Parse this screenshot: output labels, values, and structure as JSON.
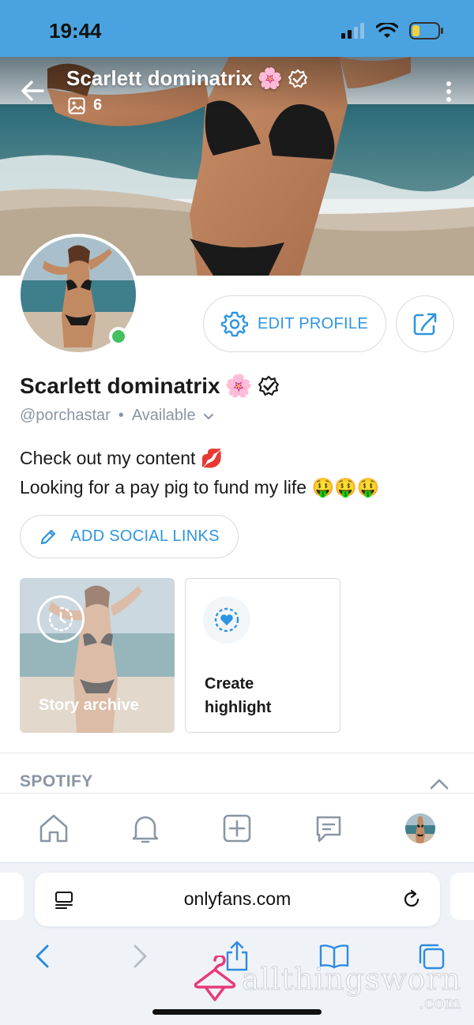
{
  "status_bar": {
    "time": "19:44"
  },
  "header": {
    "name": "Scarlett dominatrix",
    "name_emoji": "🌸",
    "media_count": "6"
  },
  "profile": {
    "name": "Scarlett dominatrix",
    "name_emoji": "🌸",
    "handle": "@porchastar",
    "separator": "•",
    "availability": "Available",
    "edit_profile_label": "EDIT PROFILE",
    "online_color": "#43c160"
  },
  "bio": {
    "line1": "Check out my content 💋",
    "line2": "Looking for a pay pig to fund my life 🤑🤑🤑"
  },
  "social": {
    "label": "ADD SOCIAL LINKS"
  },
  "highlights": {
    "story_archive_label": "Story archive",
    "create_highlight_label": "Create highlight"
  },
  "spotify": {
    "label": "SPOTIFY"
  },
  "bottom_nav": {
    "items": [
      "home-icon",
      "bell-icon",
      "add-icon",
      "messages-icon",
      "profile-avatar"
    ]
  },
  "browser": {
    "url": "onlyfans.com"
  },
  "watermark": {
    "brand": "allthingsworn",
    "tld": ".com"
  },
  "colors": {
    "accent": "#2f95e0",
    "status_bar": "#4aa3e0",
    "muted": "#8a96a3"
  }
}
